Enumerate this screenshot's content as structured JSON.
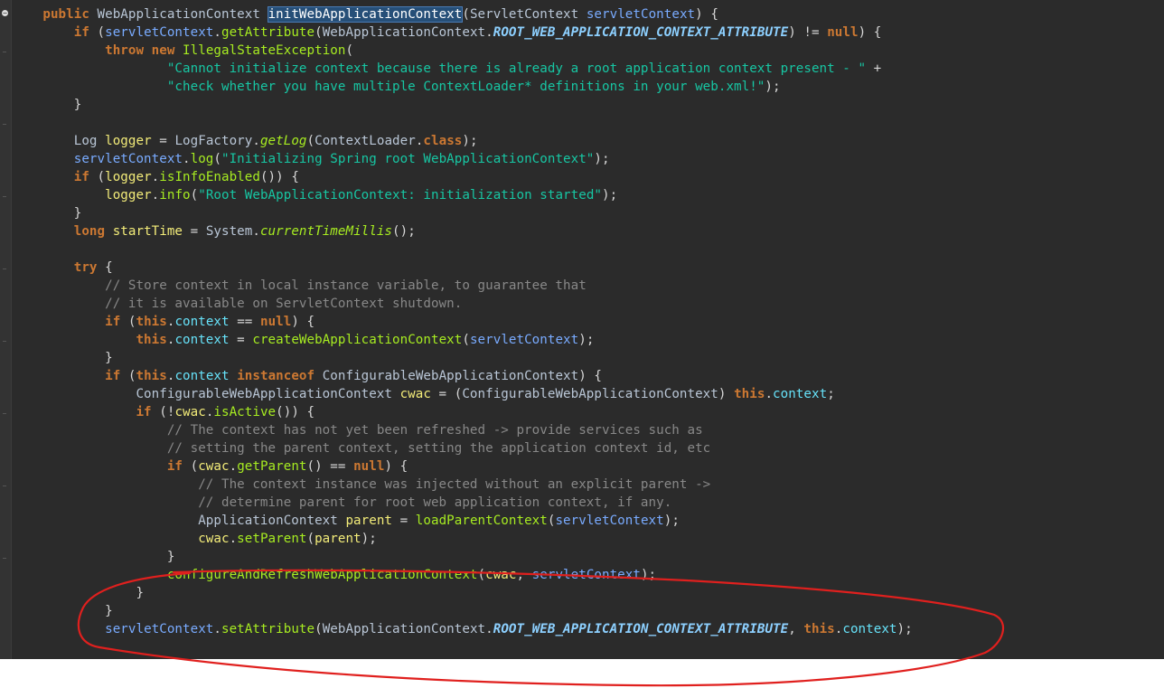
{
  "code_lines": [
    [
      {
        "t": "    "
      },
      {
        "t": "public",
        "c": "kw"
      },
      {
        "t": " "
      },
      {
        "t": "WebApplicationContext",
        "c": "ty"
      },
      {
        "t": " "
      },
      {
        "t": "initWebApplicationContext",
        "c": "sel"
      },
      {
        "t": "("
      },
      {
        "t": "ServletContext",
        "c": "ty"
      },
      {
        "t": " "
      },
      {
        "t": "servletContext",
        "c": "pa"
      },
      {
        "t": ") {"
      }
    ],
    [
      {
        "t": "        "
      },
      {
        "t": "if",
        "c": "kw"
      },
      {
        "t": " ("
      },
      {
        "t": "servletContext",
        "c": "pa"
      },
      {
        "t": "."
      },
      {
        "t": "getAttribute",
        "c": "mt"
      },
      {
        "t": "("
      },
      {
        "t": "WebApplicationContext",
        "c": "ty"
      },
      {
        "t": "."
      },
      {
        "t": "ROOT_WEB_APPLICATION_CONTEXT_ATTRIBUTE",
        "c": "ci"
      },
      {
        "t": ") != "
      },
      {
        "t": "null",
        "c": "kw"
      },
      {
        "t": ") {"
      }
    ],
    [
      {
        "t": "            "
      },
      {
        "t": "throw",
        "c": "kw"
      },
      {
        "t": " "
      },
      {
        "t": "new",
        "c": "kw"
      },
      {
        "t": " "
      },
      {
        "t": "IllegalStateException",
        "c": "mt"
      },
      {
        "t": "("
      }
    ],
    [
      {
        "t": "                    "
      },
      {
        "t": "\"Cannot initialize context because there is already a root application context present - \"",
        "c": "st"
      },
      {
        "t": " +"
      }
    ],
    [
      {
        "t": "                    "
      },
      {
        "t": "\"check whether you have multiple ContextLoader* definitions in your web.xml!\"",
        "c": "st"
      },
      {
        "t": ");"
      }
    ],
    [
      {
        "t": "        }"
      }
    ],
    [
      {
        "t": ""
      }
    ],
    [
      {
        "t": "        "
      },
      {
        "t": "Log",
        "c": "ty"
      },
      {
        "t": " "
      },
      {
        "t": "logger",
        "c": "lv"
      },
      {
        "t": " = "
      },
      {
        "t": "LogFactory",
        "c": "ty"
      },
      {
        "t": "."
      },
      {
        "t": "getLog",
        "c": "mi"
      },
      {
        "t": "("
      },
      {
        "t": "ContextLoader",
        "c": "ty"
      },
      {
        "t": "."
      },
      {
        "t": "class",
        "c": "kw"
      },
      {
        "t": ");"
      }
    ],
    [
      {
        "t": "        "
      },
      {
        "t": "servletContext",
        "c": "pa"
      },
      {
        "t": "."
      },
      {
        "t": "log",
        "c": "mt"
      },
      {
        "t": "("
      },
      {
        "t": "\"Initializing Spring root WebApplicationContext\"",
        "c": "st"
      },
      {
        "t": ");"
      }
    ],
    [
      {
        "t": "        "
      },
      {
        "t": "if",
        "c": "kw"
      },
      {
        "t": " ("
      },
      {
        "t": "logger",
        "c": "lv"
      },
      {
        "t": "."
      },
      {
        "t": "isInfoEnabled",
        "c": "mt"
      },
      {
        "t": "()) {"
      }
    ],
    [
      {
        "t": "            "
      },
      {
        "t": "logger",
        "c": "lv"
      },
      {
        "t": "."
      },
      {
        "t": "info",
        "c": "mt"
      },
      {
        "t": "("
      },
      {
        "t": "\"Root WebApplicationContext: initialization started\"",
        "c": "st"
      },
      {
        "t": ");"
      }
    ],
    [
      {
        "t": "        }"
      }
    ],
    [
      {
        "t": "        "
      },
      {
        "t": "long",
        "c": "kw"
      },
      {
        "t": " "
      },
      {
        "t": "startTime",
        "c": "lv"
      },
      {
        "t": " = "
      },
      {
        "t": "System",
        "c": "ty"
      },
      {
        "t": "."
      },
      {
        "t": "currentTimeMillis",
        "c": "mi"
      },
      {
        "t": "();"
      }
    ],
    [
      {
        "t": ""
      }
    ],
    [
      {
        "t": "        "
      },
      {
        "t": "try",
        "c": "kw"
      },
      {
        "t": " {"
      }
    ],
    [
      {
        "t": "            "
      },
      {
        "t": "// Store context in local instance variable, to guarantee that",
        "c": "cm"
      }
    ],
    [
      {
        "t": "            "
      },
      {
        "t": "// it is available on ServletContext shutdown.",
        "c": "cm"
      }
    ],
    [
      {
        "t": "            "
      },
      {
        "t": "if",
        "c": "kw"
      },
      {
        "t": " ("
      },
      {
        "t": "this",
        "c": "kw"
      },
      {
        "t": "."
      },
      {
        "t": "context",
        "c": "fd"
      },
      {
        "t": " == "
      },
      {
        "t": "null",
        "c": "kw"
      },
      {
        "t": ") {"
      }
    ],
    [
      {
        "t": "                "
      },
      {
        "t": "this",
        "c": "kw"
      },
      {
        "t": "."
      },
      {
        "t": "context",
        "c": "fd"
      },
      {
        "t": " = "
      },
      {
        "t": "createWebApplicationContext",
        "c": "mt"
      },
      {
        "t": "("
      },
      {
        "t": "servletContext",
        "c": "pa"
      },
      {
        "t": ");"
      }
    ],
    [
      {
        "t": "            }"
      }
    ],
    [
      {
        "t": "            "
      },
      {
        "t": "if",
        "c": "kw"
      },
      {
        "t": " ("
      },
      {
        "t": "this",
        "c": "kw"
      },
      {
        "t": "."
      },
      {
        "t": "context",
        "c": "fd"
      },
      {
        "t": " "
      },
      {
        "t": "instanceof",
        "c": "kw"
      },
      {
        "t": " "
      },
      {
        "t": "ConfigurableWebApplicationContext",
        "c": "ty"
      },
      {
        "t": ") {"
      }
    ],
    [
      {
        "t": "                "
      },
      {
        "t": "ConfigurableWebApplicationContext",
        "c": "ty"
      },
      {
        "t": " "
      },
      {
        "t": "cwac",
        "c": "lv"
      },
      {
        "t": " = ("
      },
      {
        "t": "ConfigurableWebApplicationContext",
        "c": "ty"
      },
      {
        "t": ") "
      },
      {
        "t": "this",
        "c": "kw"
      },
      {
        "t": "."
      },
      {
        "t": "context",
        "c": "fd"
      },
      {
        "t": ";"
      }
    ],
    [
      {
        "t": "                "
      },
      {
        "t": "if",
        "c": "kw"
      },
      {
        "t": " (!"
      },
      {
        "t": "cwac",
        "c": "lv"
      },
      {
        "t": "."
      },
      {
        "t": "isActive",
        "c": "mt"
      },
      {
        "t": "()) {"
      }
    ],
    [
      {
        "t": "                    "
      },
      {
        "t": "// The context has not yet been refreshed -> provide services such as",
        "c": "cm"
      }
    ],
    [
      {
        "t": "                    "
      },
      {
        "t": "// setting the parent context, setting the application context id, etc",
        "c": "cm"
      }
    ],
    [
      {
        "t": "                    "
      },
      {
        "t": "if",
        "c": "kw"
      },
      {
        "t": " ("
      },
      {
        "t": "cwac",
        "c": "lv"
      },
      {
        "t": "."
      },
      {
        "t": "getParent",
        "c": "mt"
      },
      {
        "t": "() == "
      },
      {
        "t": "null",
        "c": "kw"
      },
      {
        "t": ") {"
      }
    ],
    [
      {
        "t": "                        "
      },
      {
        "t": "// The context instance was injected without an explicit parent ->",
        "c": "cm"
      }
    ],
    [
      {
        "t": "                        "
      },
      {
        "t": "// determine parent for root web application context, if any.",
        "c": "cm"
      }
    ],
    [
      {
        "t": "                        "
      },
      {
        "t": "ApplicationContext",
        "c": "ty"
      },
      {
        "t": " "
      },
      {
        "t": "parent",
        "c": "lv"
      },
      {
        "t": " = "
      },
      {
        "t": "loadParentContext",
        "c": "mt"
      },
      {
        "t": "("
      },
      {
        "t": "servletContext",
        "c": "pa"
      },
      {
        "t": ");"
      }
    ],
    [
      {
        "t": "                        "
      },
      {
        "t": "cwac",
        "c": "lv"
      },
      {
        "t": "."
      },
      {
        "t": "setParent",
        "c": "mt"
      },
      {
        "t": "("
      },
      {
        "t": "parent",
        "c": "lv"
      },
      {
        "t": ");"
      }
    ],
    [
      {
        "t": "                    }"
      }
    ],
    [
      {
        "t": "                    "
      },
      {
        "t": "configureAndRefreshWebApplicationContext",
        "c": "mt"
      },
      {
        "t": "("
      },
      {
        "t": "cwac",
        "c": "lv"
      },
      {
        "t": ", "
      },
      {
        "t": "servletContext",
        "c": "pa"
      },
      {
        "t": ");"
      }
    ],
    [
      {
        "t": "                }"
      }
    ],
    [
      {
        "t": "            }"
      }
    ],
    [
      {
        "t": "            "
      },
      {
        "t": "servletContext",
        "c": "pa"
      },
      {
        "t": "."
      },
      {
        "t": "setAttribute",
        "c": "mt"
      },
      {
        "t": "("
      },
      {
        "t": "WebApplicationContext",
        "c": "ty"
      },
      {
        "t": "."
      },
      {
        "t": "ROOT_WEB_APPLICATION_CONTEXT_ATTRIBUTE",
        "c": "ci"
      },
      {
        "t": ", "
      },
      {
        "t": "this",
        "c": "kw"
      },
      {
        "t": "."
      },
      {
        "t": "context",
        "c": "fd"
      },
      {
        "t": ");"
      }
    ]
  ],
  "colors": {
    "editor_bg": "#2b2b2b",
    "keyword": "#cc7832",
    "method": "#a7ec21",
    "string": "#17c6a3",
    "comment": "#888888",
    "annotation": "#e0201e"
  }
}
